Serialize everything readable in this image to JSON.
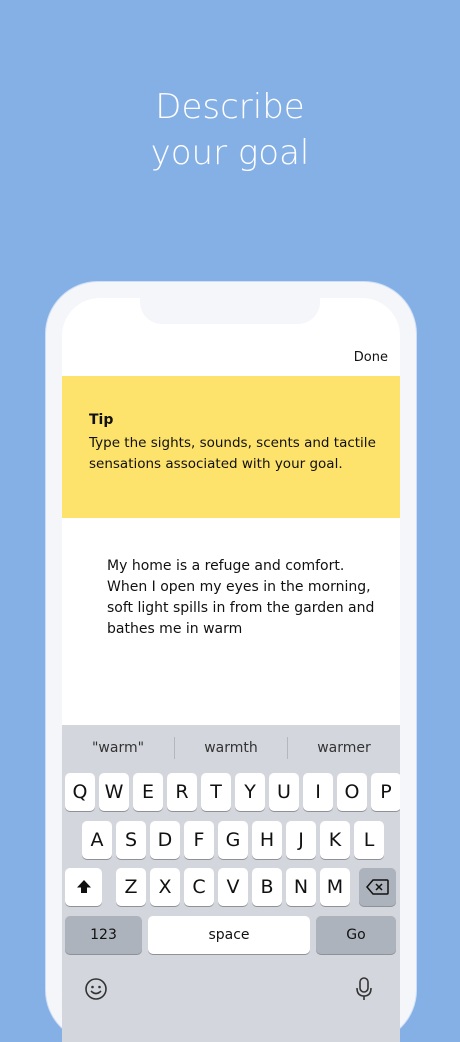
{
  "headline": {
    "line1": "Describe",
    "line2": "your goal"
  },
  "toolbar": {
    "done_label": "Done"
  },
  "tip": {
    "title": "Tip",
    "body": "Type the sights, sounds, scents and tactile sensations associated with your goal."
  },
  "entry": {
    "text": "My home is a refuge and comfort. When I open my eyes in the morning, soft light spills in from the garden and bathes me in warm"
  },
  "keyboard": {
    "suggestions": [
      "\"warm\"",
      "warmth",
      "warmer"
    ],
    "row1": [
      "Q",
      "W",
      "E",
      "R",
      "T",
      "Y",
      "U",
      "I",
      "O",
      "P"
    ],
    "row2": [
      "A",
      "S",
      "D",
      "F",
      "G",
      "H",
      "J",
      "K",
      "L"
    ],
    "row3": [
      "Z",
      "X",
      "C",
      "V",
      "B",
      "N",
      "M"
    ],
    "numbers_label": "123",
    "space_label": "space",
    "go_label": "Go",
    "shift_icon": "shift-icon",
    "backspace_icon": "backspace-icon",
    "emoji_icon": "emoji-icon",
    "mic_icon": "microphone-icon"
  }
}
